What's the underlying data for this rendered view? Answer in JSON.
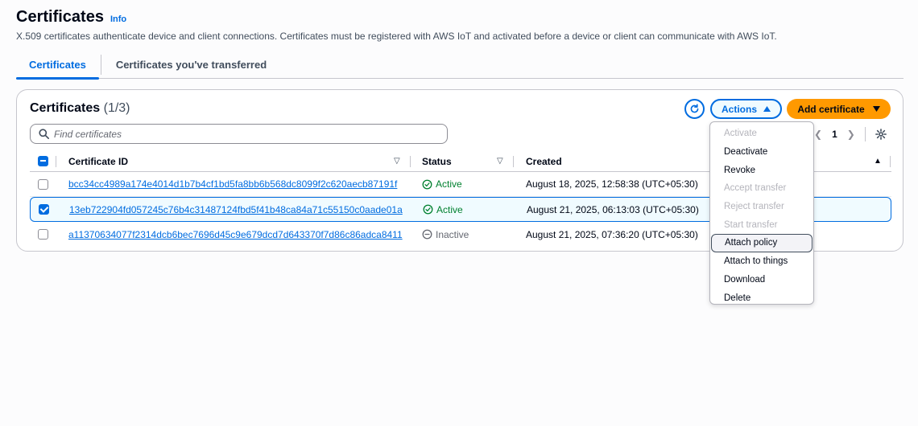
{
  "header": {
    "title": "Certificates",
    "info": "Info",
    "description": "X.509 certificates authenticate device and client connections. Certificates must be registered with AWS IoT and activated before a device or client can communicate with AWS IoT."
  },
  "tabs": [
    {
      "label": "Certificates",
      "active": true
    },
    {
      "label": "Certificates you've transferred",
      "active": false
    }
  ],
  "panel": {
    "title": "Certificates",
    "count": "(1/3)",
    "actions_label": "Actions",
    "add_label": "Add certificate",
    "search_placeholder": "Find certificates",
    "page": "1"
  },
  "table": {
    "columns": [
      "Certificate ID",
      "Status",
      "Created"
    ],
    "rows": [
      {
        "id": "bcc34cc4989a174e4014d1b7b4cf1bd5fa8bb6b568dc8099f2c620aecb87191f",
        "status": "Active",
        "created": "August 18, 2025, 12:58:38 (UTC+05:30)",
        "selected": false
      },
      {
        "id": "13eb722904fd057245c76b4c31487124fbd5f41b48ca84a71c55150c0aade01a",
        "status": "Active",
        "created": "August 21, 2025, 06:13:03 (UTC+05:30)",
        "selected": true
      },
      {
        "id": "a11370634077f2314dcb6bec7696d45c9e679dcd7d643370f7d86c86adca8411",
        "status": "Inactive",
        "created": "August 21, 2025, 07:36:20 (UTC+05:30)",
        "selected": false
      }
    ]
  },
  "actions_menu": [
    {
      "label": "Activate",
      "disabled": true
    },
    {
      "label": "Deactivate",
      "disabled": false
    },
    {
      "label": "Revoke",
      "disabled": false
    },
    {
      "label": "Accept transfer",
      "disabled": true
    },
    {
      "label": "Reject transfer",
      "disabled": true
    },
    {
      "label": "Start transfer",
      "disabled": true
    },
    {
      "label": "Attach policy",
      "disabled": false
    },
    {
      "label": "Attach to things",
      "disabled": false
    },
    {
      "label": "Download",
      "disabled": false
    },
    {
      "label": "Delete",
      "disabled": false
    }
  ],
  "colors": {
    "accent": "#006ce0",
    "primary_button": "#ff9900",
    "active_status": "#00802f",
    "inactive_status": "#656871"
  }
}
